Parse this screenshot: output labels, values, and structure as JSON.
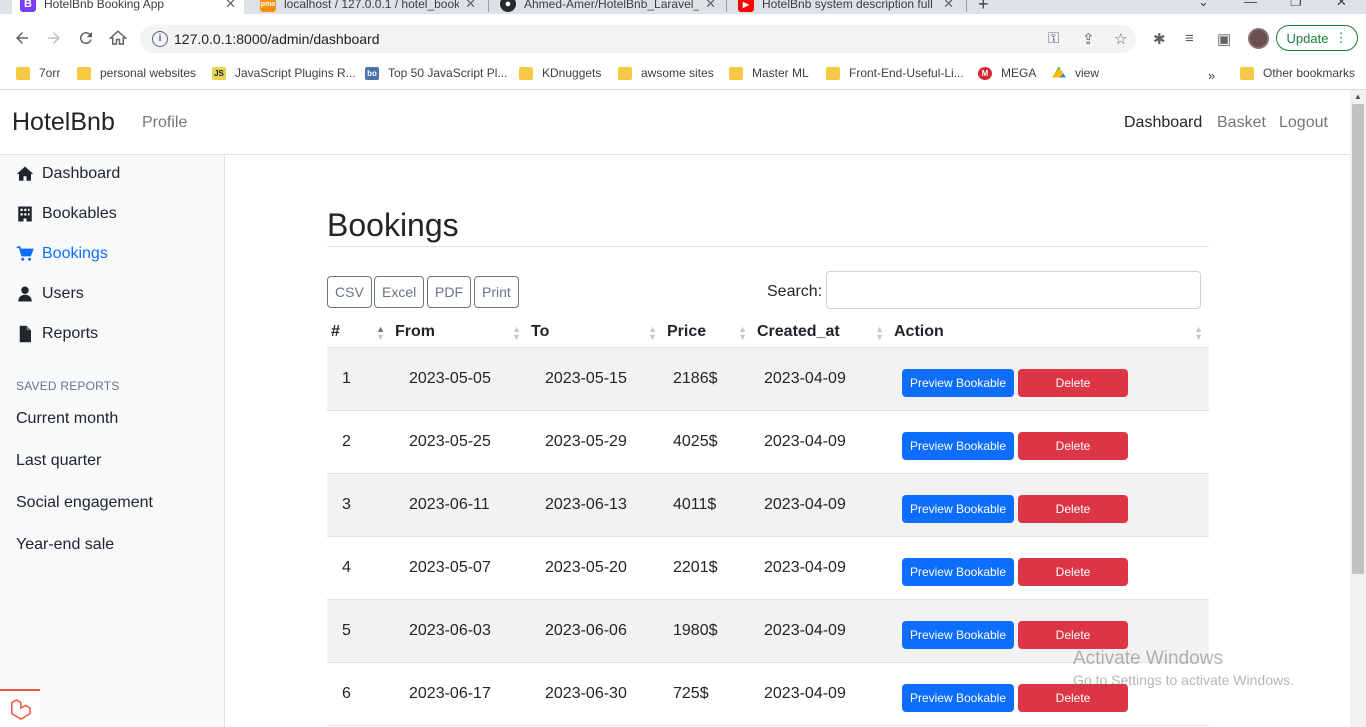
{
  "browser": {
    "tabs": [
      {
        "title": "HotelBnb Booking App",
        "icon": "B"
      },
      {
        "title": "localhost / 127.0.0.1 / hotel_book",
        "icon": "pma"
      },
      {
        "title": "Ahmed-Amer/HotelBnb_Laravel_",
        "icon": "github"
      },
      {
        "title": "HotelBnb system description full",
        "icon": "youtube"
      }
    ],
    "url": "127.0.0.1:8000/admin/dashboard",
    "update_label": "Update",
    "bookmarks": [
      "7orr",
      "personal websites",
      "JavaScript Plugins R...",
      "Top 50 JavaScript Pl...",
      "KDnuggets",
      "awsome sites",
      "Master ML",
      "Front-End-Useful-Li...",
      "MEGA",
      "view"
    ],
    "other_bookmarks": "Other bookmarks"
  },
  "app": {
    "brand": "HotelBnb",
    "profile": "Profile",
    "nav": {
      "dashboard": "Dashboard",
      "basket": "Basket",
      "logout": "Logout"
    }
  },
  "sidebar": {
    "items": [
      "Dashboard",
      "Bookables",
      "Bookings",
      "Users",
      "Reports"
    ],
    "active": "Bookings",
    "saved_heading": "SAVED REPORTS",
    "reports": [
      "Current month",
      "Last quarter",
      "Social engagement",
      "Year-end sale"
    ]
  },
  "page": {
    "title": "Bookings",
    "export_buttons": [
      "CSV",
      "Excel",
      "PDF",
      "Print"
    ],
    "search_label": "Search:",
    "search_value": "",
    "columns": [
      "#",
      "From",
      "To",
      "Price",
      "Created_at",
      "Action"
    ],
    "rows": [
      {
        "id": "1",
        "from": "2023-05-05",
        "to": "2023-05-15",
        "price": "2186$",
        "created": "2023-04-09"
      },
      {
        "id": "2",
        "from": "2023-05-25",
        "to": "2023-05-29",
        "price": "4025$",
        "created": "2023-04-09"
      },
      {
        "id": "3",
        "from": "2023-06-11",
        "to": "2023-06-13",
        "price": "4011$",
        "created": "2023-04-09"
      },
      {
        "id": "4",
        "from": "2023-05-07",
        "to": "2023-05-20",
        "price": "2201$",
        "created": "2023-04-09"
      },
      {
        "id": "5",
        "from": "2023-06-03",
        "to": "2023-06-06",
        "price": "1980$",
        "created": "2023-04-09"
      },
      {
        "id": "6",
        "from": "2023-06-17",
        "to": "2023-06-30",
        "price": "725$",
        "created": "2023-04-09"
      }
    ],
    "preview_label": "Preview Bookable",
    "delete_label": "Delete"
  },
  "watermark": {
    "line1": "Activate Windows",
    "line2": "Go to Settings to activate Windows."
  },
  "colors": {
    "primary": "#0d6efd",
    "danger": "#dc3545",
    "sidebar_bg": "#f8f9fa"
  }
}
